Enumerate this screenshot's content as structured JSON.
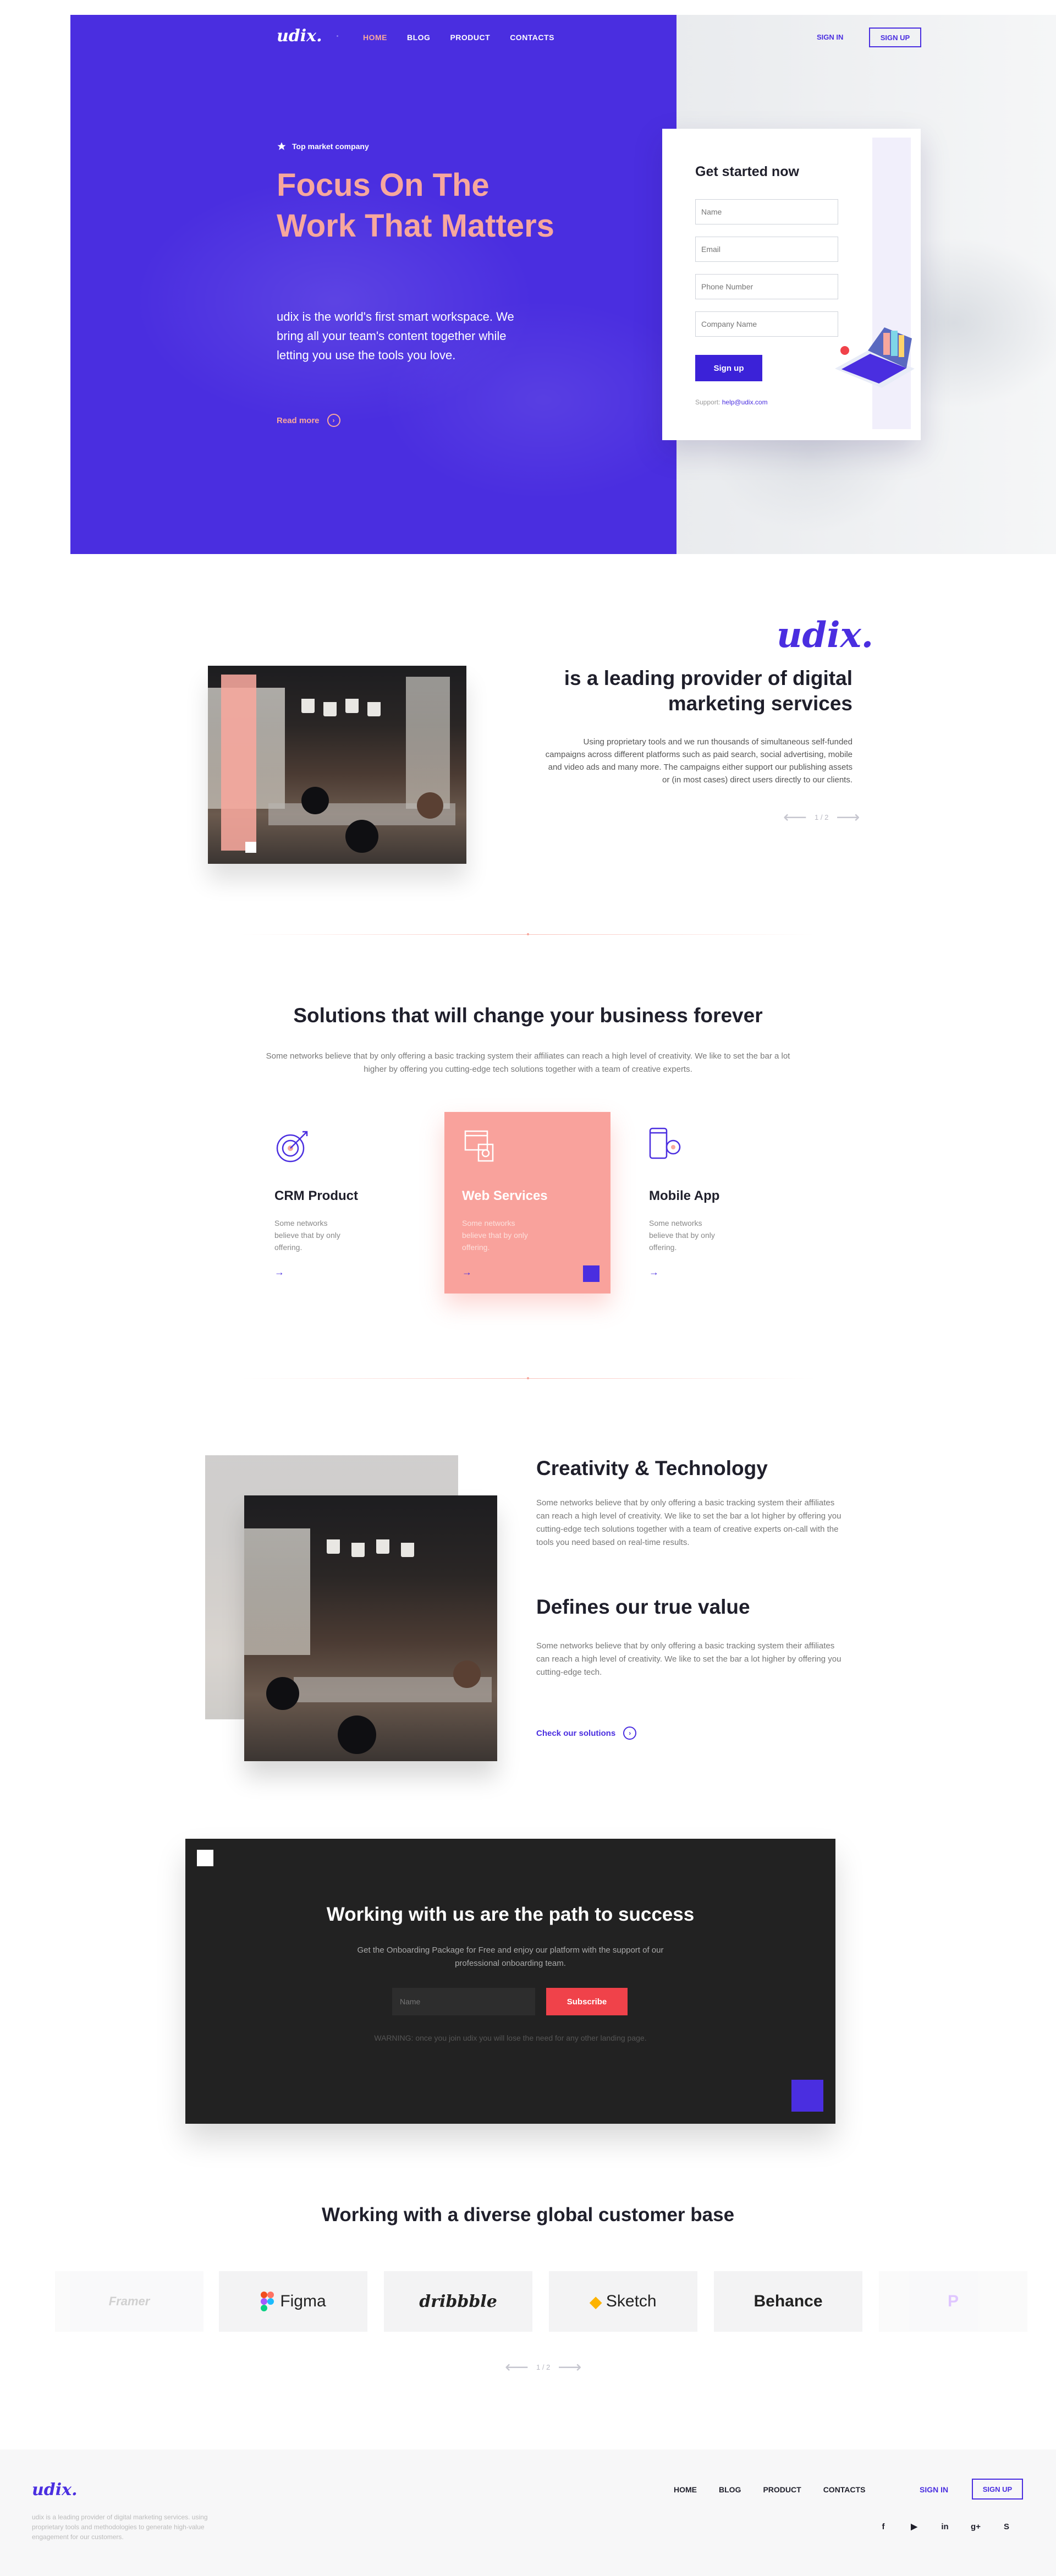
{
  "nav": {
    "logo": "udix.",
    "links": [
      "HOME",
      "BLOG",
      "PRODUCT",
      "CONTACTS"
    ],
    "signin": "SIGN IN",
    "signup": "SIGN UP"
  },
  "hero": {
    "badge": "Top market company",
    "title": "Focus On The Work That Matters",
    "text": "udix is the world's first smart workspace. We bring all your team's content together while letting you use the tools you love.",
    "read_more": "Read more"
  },
  "signup_form": {
    "title": "Get started now",
    "placeholders": {
      "name": "Name",
      "email": "Email",
      "phone": "Phone Number",
      "company": "Company Name"
    },
    "button": "Sign up",
    "support_label": "Support:",
    "support_email": "help@udix.com"
  },
  "about": {
    "logo": "udix.",
    "title": "is a leading provider of digital marketing services",
    "text": "Using proprietary tools and we run thousands of simultaneous self-funded campaigns across different platforms such as paid search, social advertising, mobile and video ads and many more. The campaigns either support our publishing assets or (in most cases) direct users directly to our clients.",
    "pager": "1 / 2"
  },
  "solutions": {
    "title": "Solutions that will change your business forever",
    "text": "Some networks believe that by only offering a basic tracking system their affiliates can reach a high level of creativity. We like to set the bar a lot higher by offering you cutting-edge tech solutions together with a team of creative experts.",
    "cards": [
      {
        "name": "CRM Product",
        "desc": "Some networks believe that by only offering.",
        "icon": "target-icon"
      },
      {
        "name": "Web Services",
        "desc": "Some networks believe that by only offering.",
        "icon": "web-services-icon"
      },
      {
        "name": "Mobile App",
        "desc": "Some networks believe that by only offering.",
        "icon": "mobile-app-icon"
      }
    ]
  },
  "features": {
    "h1": "Creativity & Technology",
    "t1": "Some networks believe that by only offering a basic tracking system their affiliates can reach a high level of creativity. We like to set the bar a lot higher by offering you cutting-edge tech solutions together with a team of creative experts on-call with the tools you need based on real-time results.",
    "h2": "Defines our true value",
    "t2": "Some networks believe that by only offering a basic tracking system their affiliates can reach a high level of creativity. We like to set the bar a lot higher by offering you cutting-edge tech.",
    "link": "Check our solutions"
  },
  "cta": {
    "title": "Working with us are the path to success",
    "text": "Get the Onboarding Package for Free and enjoy our platform with the support of our professional onboarding team.",
    "input_placeholder": "Name",
    "button": "Subscribe",
    "warning": "WARNING: once you join udix you will lose the need for any other landing page."
  },
  "clients": {
    "title": "Working with a diverse global customer base",
    "logos": [
      "Framer",
      "Figma",
      "dribbble",
      "Sketch",
      "Behance",
      "P"
    ],
    "pager": "1 / 2"
  },
  "footer": {
    "logo": "udix.",
    "text": "udix is a leading provider of digital marketing services. using proprietary tools and methodologies to generate high-value engagement for our customers.",
    "links": [
      "HOME",
      "BLOG",
      "PRODUCT",
      "CONTACTS"
    ],
    "signin": "SIGN IN",
    "signup": "SIGN UP",
    "socials": [
      "f",
      "▶",
      "in",
      "g+",
      "S"
    ]
  },
  "colors": {
    "primary": "#4a2ee0",
    "accent": "#f7a79d",
    "cta_bg": "#222222",
    "subscribe": "#f0424a"
  }
}
